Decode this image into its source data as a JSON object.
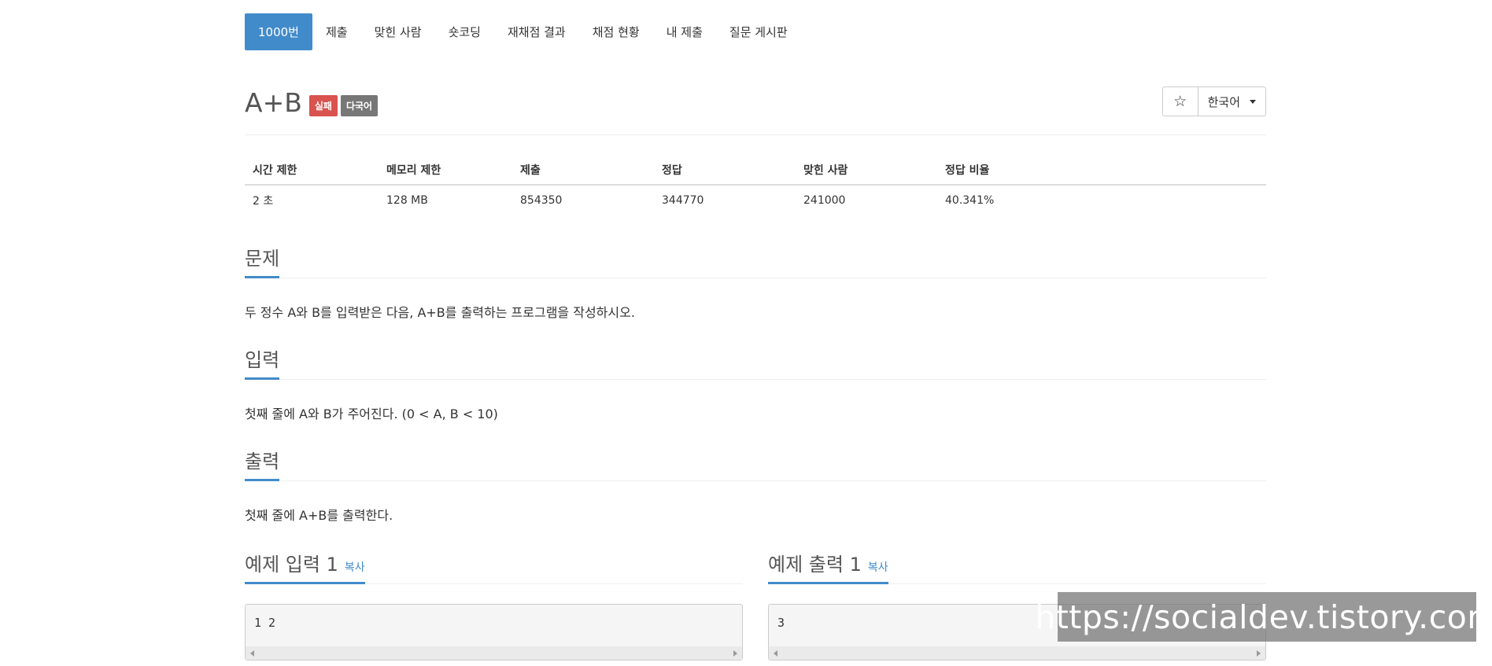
{
  "nav": {
    "tabs": [
      {
        "label": "1000번",
        "active": true
      },
      {
        "label": "제출"
      },
      {
        "label": "맞힌 사람"
      },
      {
        "label": "숏코딩"
      },
      {
        "label": "재채점 결과"
      },
      {
        "label": "채점 현황"
      },
      {
        "label": "내 제출"
      },
      {
        "label": "질문 게시판"
      }
    ]
  },
  "problem": {
    "title": "A+B",
    "labels": {
      "fail": "실패",
      "multi": "다국어"
    },
    "star_icon": "☆",
    "language": "한국어"
  },
  "info": {
    "headers": [
      "시간 제한",
      "메모리 제한",
      "제출",
      "정답",
      "맞힌 사람",
      "정답 비율"
    ],
    "values": [
      "2 초",
      "128 MB",
      "854350",
      "344770",
      "241000",
      "40.341%"
    ]
  },
  "sections": {
    "description": {
      "title": "문제",
      "text": "두 정수 A와 B를 입력받은 다음, A+B를 출력하는 프로그램을 작성하시오."
    },
    "input": {
      "title": "입력",
      "text": "첫째 줄에 A와 B가 주어진다. (0 < A, B < 10)"
    },
    "output": {
      "title": "출력",
      "text": "첫째 줄에 A+B를 출력한다."
    }
  },
  "samples": {
    "input": {
      "title": "예제 입력 1",
      "copy": "복사",
      "content": "1 2"
    },
    "output": {
      "title": "예제 출력 1",
      "copy": "복사",
      "content": "3"
    }
  },
  "watermark": "https://socialdev.tistory.com",
  "colors": {
    "primary": "#428bca",
    "fail": "#d9534f",
    "multi": "#777777"
  }
}
